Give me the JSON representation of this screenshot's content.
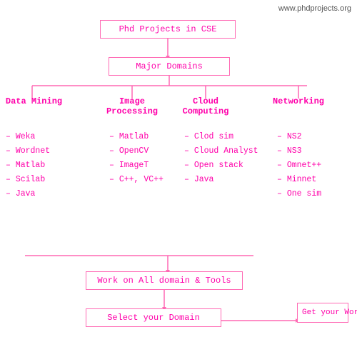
{
  "watermark": "www.phdprojects.org",
  "boxes": {
    "phd": "Phd Projects in CSE",
    "major": "Major Domains",
    "work": "Work on All domain & Tools",
    "select": "Select your Domain",
    "get": "Get your Work"
  },
  "domains": {
    "datamining": "Data Mining",
    "imageprocessing": "Image\nProcessing",
    "cloudcomputing": "Cloud\nComputing",
    "networking": "Networking"
  },
  "lists": {
    "dm": [
      "Weka",
      "Wordnet",
      "Matlab",
      "Scilab",
      "Java"
    ],
    "ip": [
      "Matlab",
      "OpenCV",
      "ImageT",
      "C++, VC++"
    ],
    "cc": [
      "Clod sim",
      "Cloud Analyst",
      "Open stack",
      "Java"
    ],
    "net": [
      "NS2",
      "NS3",
      "Omnet++",
      "Minnet",
      "One sim"
    ]
  }
}
